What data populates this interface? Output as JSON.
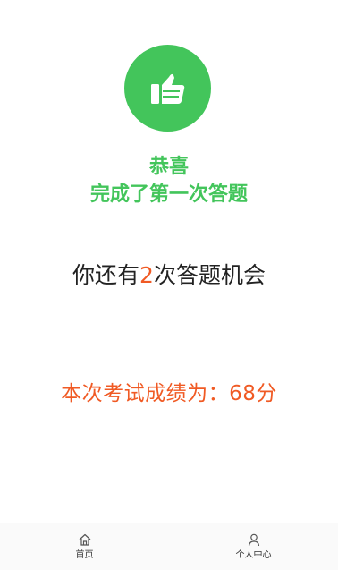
{
  "result": {
    "congrats_line1": "恭喜",
    "congrats_line2": "完成了第一次答题",
    "remaining_prefix": "你还有",
    "remaining_count": "2",
    "remaining_suffix": "次答题机会",
    "score_text": "本次考试成绩为：68分",
    "badge_icon": "thumbs-up-icon"
  },
  "colors": {
    "accent_green": "#43c55b",
    "accent_orange": "#f05a24"
  },
  "tabbar": {
    "items": [
      {
        "label": "首页",
        "icon": "home-icon"
      },
      {
        "label": "个人中心",
        "icon": "person-icon"
      }
    ]
  }
}
